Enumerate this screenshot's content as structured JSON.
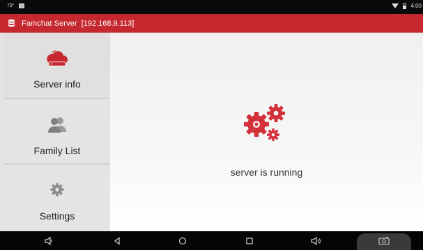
{
  "status_bar": {
    "left_text": "79°",
    "time": "4:00"
  },
  "app_bar": {
    "title": "Famchat Server",
    "address": "[192.168.9.113]",
    "accent": "#c6282f"
  },
  "sidebar": {
    "items": [
      {
        "label": "Server info",
        "icon": "router-cloud-icon",
        "active": true
      },
      {
        "label": "Family List",
        "icon": "people-icon",
        "active": false
      },
      {
        "label": "Settings",
        "icon": "gear-icon",
        "active": false
      }
    ]
  },
  "main": {
    "status_text": "server is running",
    "status_icon": "gears-icon"
  },
  "nav_bar": {
    "buttons": [
      "volume-down-icon",
      "back-icon",
      "home-icon",
      "recents-icon",
      "volume-up-icon",
      "screenshot-icon"
    ]
  }
}
